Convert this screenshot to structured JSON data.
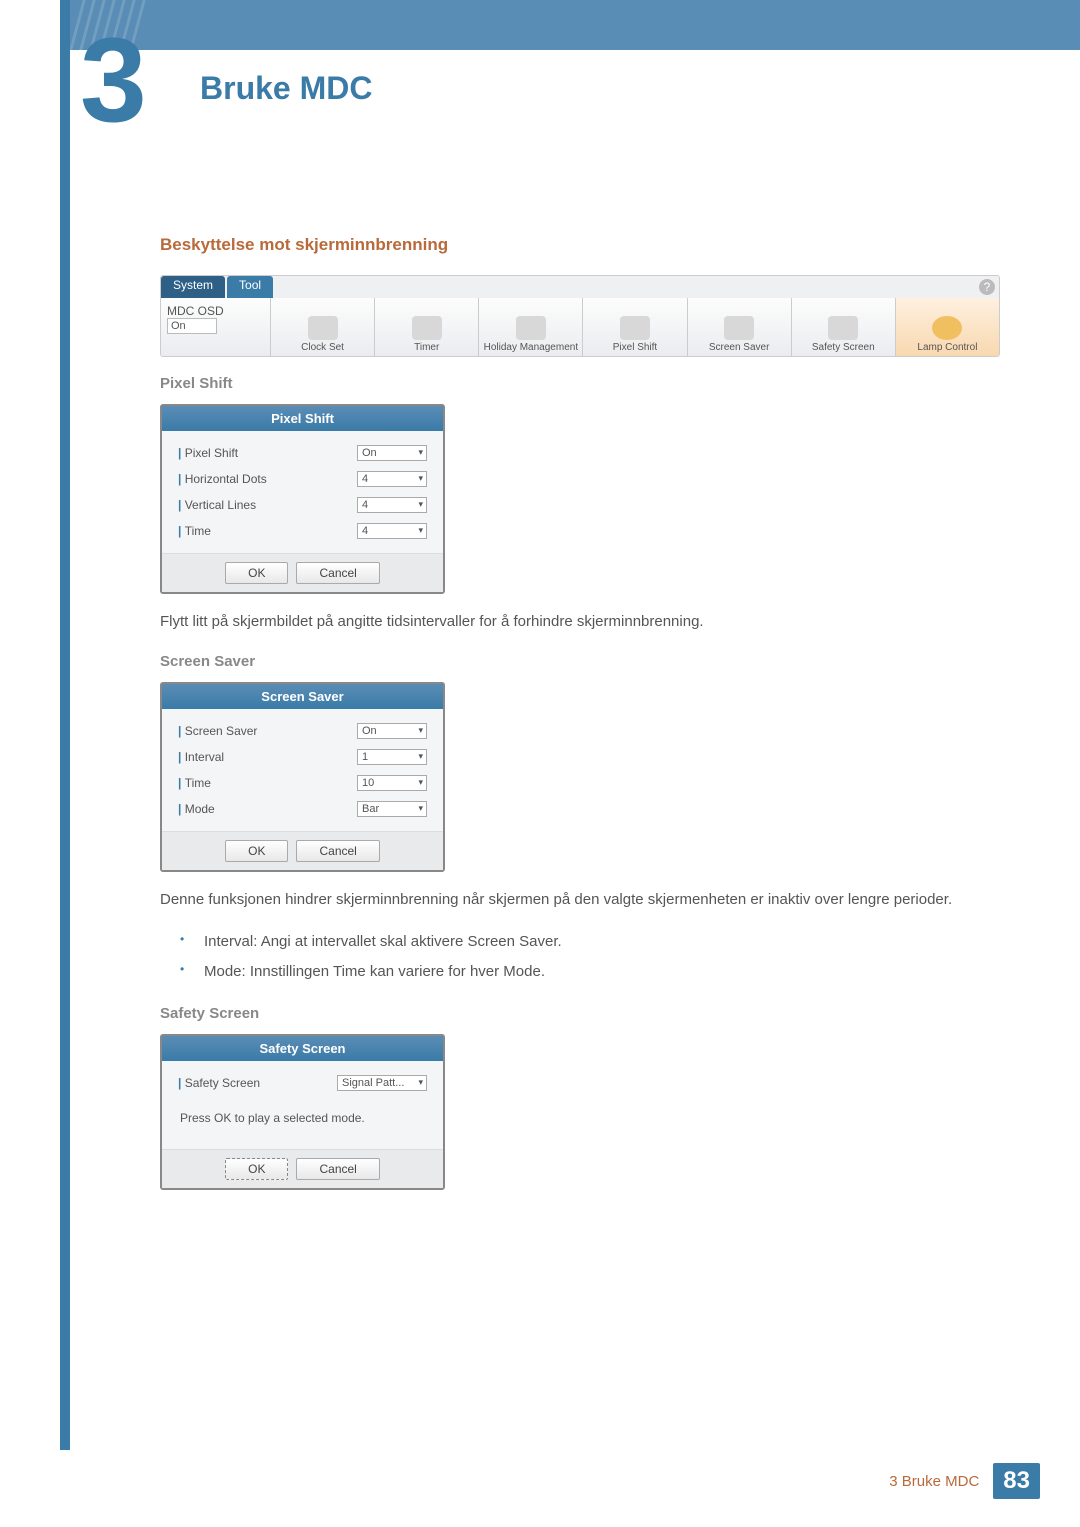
{
  "chapter": {
    "number": "3",
    "title": "Bruke MDC"
  },
  "section": {
    "heading": "Beskyttelse mot skjerminnbrenning"
  },
  "ribbon": {
    "tabs": [
      "System",
      "Tool"
    ],
    "help": "?",
    "left": {
      "label": "MDC OSD",
      "value": "On"
    },
    "items": [
      {
        "label": "Clock Set"
      },
      {
        "label": "Timer"
      },
      {
        "label": "Holiday Management"
      },
      {
        "label": "Pixel Shift"
      },
      {
        "label": "Screen Saver"
      },
      {
        "label": "Safety Screen"
      },
      {
        "label": "Lamp Control"
      }
    ]
  },
  "pixel_shift": {
    "heading": "Pixel Shift",
    "title": "Pixel Shift",
    "rows": [
      {
        "label": "Pixel Shift",
        "value": "On"
      },
      {
        "label": "Horizontal Dots",
        "value": "4"
      },
      {
        "label": "Vertical Lines",
        "value": "4"
      },
      {
        "label": "Time",
        "value": "4"
      }
    ],
    "ok": "OK",
    "cancel": "Cancel",
    "desc": "Flytt litt på skjermbildet på angitte tidsintervaller for å forhindre skjerminnbrenning."
  },
  "screen_saver": {
    "heading": "Screen Saver",
    "title": "Screen Saver",
    "rows": [
      {
        "label": "Screen Saver",
        "value": "On"
      },
      {
        "label": "Interval",
        "value": "1"
      },
      {
        "label": "Time",
        "value": "10"
      },
      {
        "label": "Mode",
        "value": "Bar"
      }
    ],
    "ok": "OK",
    "cancel": "Cancel",
    "desc": "Denne funksjonen hindrer skjerminnbrenning når skjermen på den valgte skjermenheten er inaktiv over lengre perioder.",
    "bullets": [
      "Interval: Angi at intervallet skal aktivere Screen Saver.",
      "Mode: Innstillingen Time kan variere for hver Mode."
    ]
  },
  "safety_screen": {
    "heading": "Safety Screen",
    "title": "Safety Screen",
    "rows": [
      {
        "label": "Safety Screen",
        "value": "Signal Patt..."
      }
    ],
    "msg": "Press OK to play a selected mode.",
    "ok": "OK",
    "cancel": "Cancel"
  },
  "footer": {
    "text": "3 Bruke MDC",
    "page": "83"
  }
}
